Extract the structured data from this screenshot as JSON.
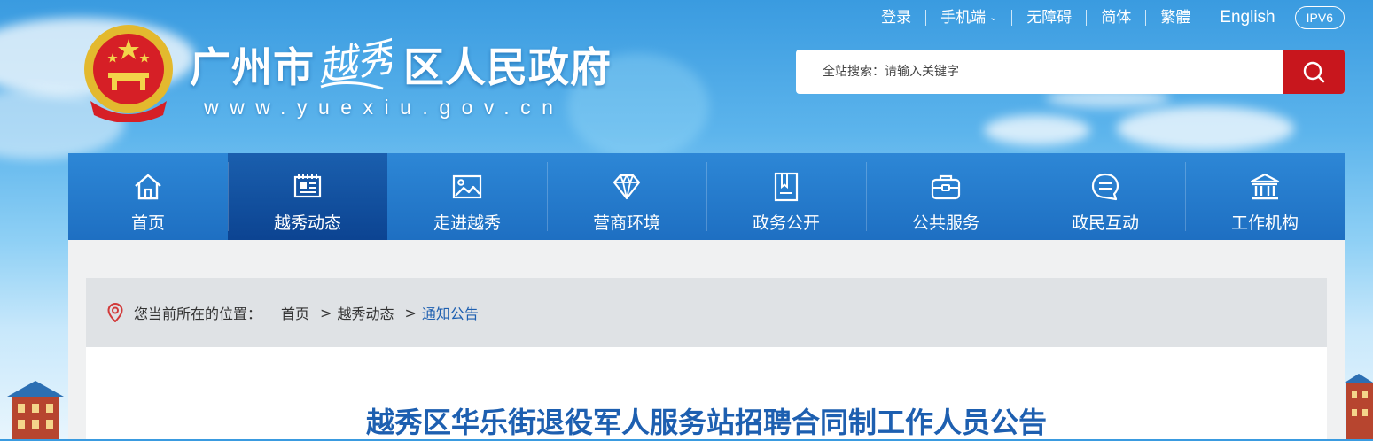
{
  "topbar": {
    "login": "登录",
    "mobile": "手机端",
    "accessibility": "无障碍",
    "simplified": "简体",
    "traditional": "繁體",
    "english": "English",
    "ipv6": "IPV6"
  },
  "header": {
    "title_left": "广州市",
    "title_calligraphy": "越秀",
    "title_right": "区人民政府",
    "domain": "www.yuexiu.gov.cn"
  },
  "search": {
    "placeholder": "全站搜索：请输入关键字",
    "value": ""
  },
  "nav": {
    "items": [
      {
        "label": "首页",
        "icon": "home-icon"
      },
      {
        "label": "越秀动态",
        "icon": "news-icon",
        "active": true
      },
      {
        "label": "走进越秀",
        "icon": "image-icon"
      },
      {
        "label": "营商环境",
        "icon": "diamond-icon"
      },
      {
        "label": "政务公开",
        "icon": "document-icon"
      },
      {
        "label": "公共服务",
        "icon": "briefcase-icon"
      },
      {
        "label": "政民互动",
        "icon": "chat-icon"
      },
      {
        "label": "工作机构",
        "icon": "institution-icon"
      }
    ]
  },
  "breadcrumb": {
    "prefix": "您当前所在的位置：",
    "items": [
      "首页",
      "越秀动态",
      "通知公告"
    ],
    "separator": ">"
  },
  "article": {
    "title": "越秀区华乐街退役军人服务站招聘合同制工作人员公告"
  },
  "colors": {
    "nav_bg": "#2d87d6",
    "nav_active": "#0b4290",
    "search_button": "#c8161d",
    "title_blue": "#1d5fb0"
  }
}
